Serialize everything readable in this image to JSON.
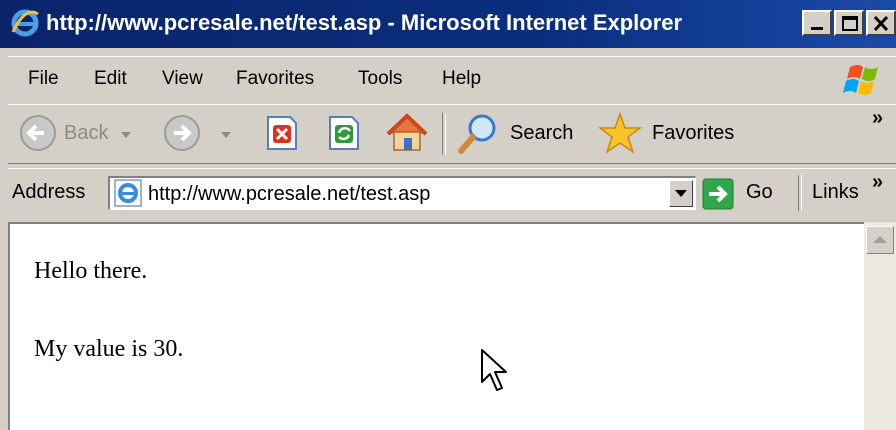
{
  "window": {
    "title": "http://www.pcresale.net/test.asp - Microsoft Internet Explorer",
    "controls": [
      "minimize",
      "maximize",
      "close"
    ]
  },
  "menu": {
    "items": [
      "File",
      "Edit",
      "View",
      "Favorites",
      "Tools",
      "Help"
    ]
  },
  "toolbar": {
    "back_label": "Back",
    "search_label": "Search",
    "favorites_label": "Favorites",
    "more_label": "»"
  },
  "address": {
    "label": "Address",
    "url": "http://www.pcresale.net/test.asp",
    "go_label": "Go",
    "links_label": "Links",
    "links_more": "»"
  },
  "content": {
    "line1": "Hello there.",
    "line2": "My value is 30."
  },
  "colors": {
    "titlebar": "#0a246a",
    "chrome": "#d4d0c8",
    "page": "#ffffff"
  }
}
